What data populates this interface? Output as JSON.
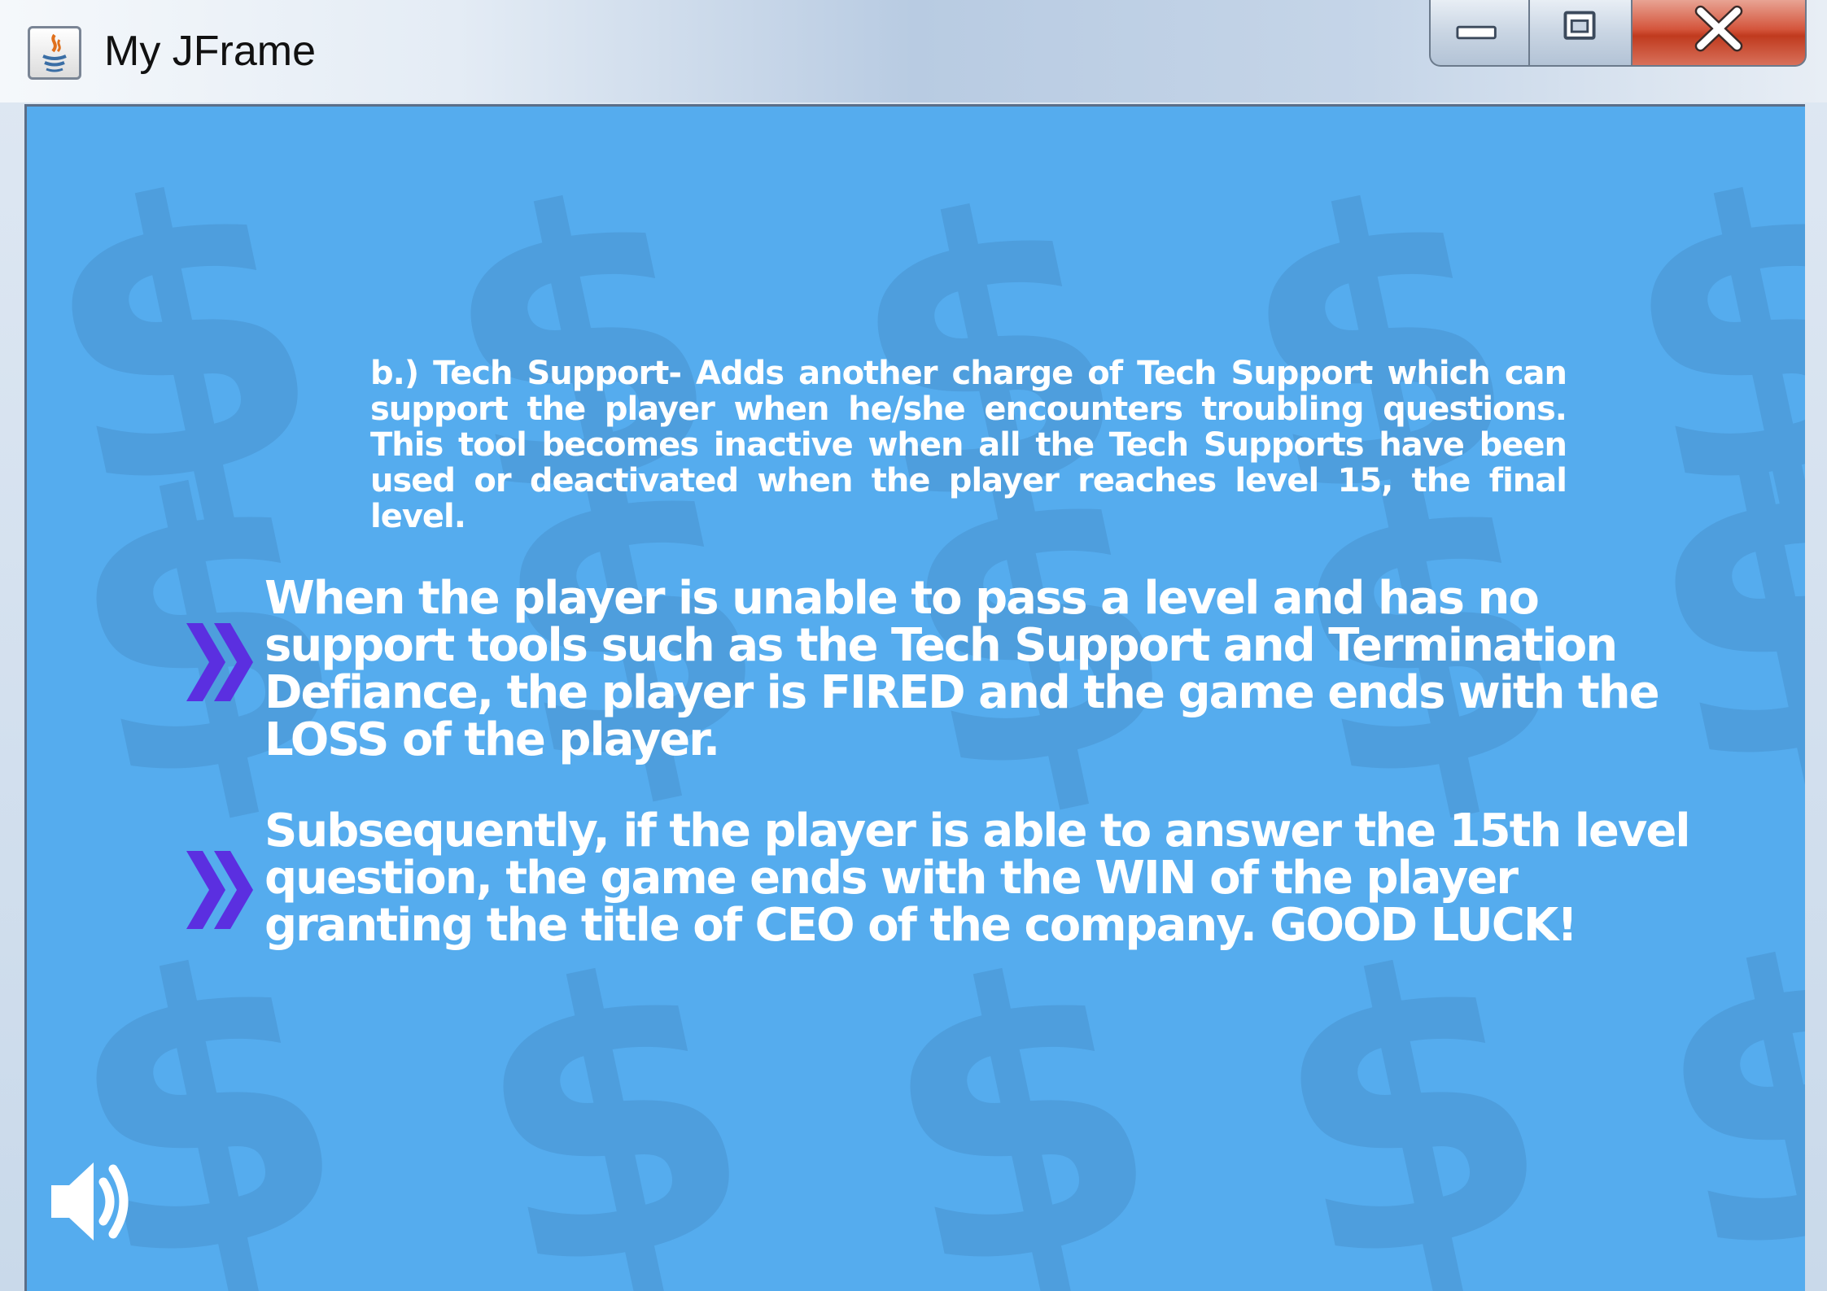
{
  "window": {
    "title": "My JFrame",
    "icon": "java-icon",
    "controls": [
      "minimize-icon",
      "maximize-icon",
      "close-icon"
    ]
  },
  "content": {
    "background_color": "#55acee",
    "watermark_glyph": "$",
    "paragraph": "b.) Tech Support- Adds another charge of Tech Support which can support the player when he/she encounters troubling questions. This tool becomes inactive when all the Tech Supports have been used or deactivated when the player reaches level 15, the final level.",
    "bullets": [
      {
        "icon": "double-chevron-right-icon",
        "text": "When the player is unable to pass a level and has no support tools such as the Tech Support and Termination Defiance, the player is FIRED and the game ends with the LOSS of the player."
      },
      {
        "icon": "double-chevron-right-icon",
        "text": "Subsequently, if the player is able to answer the 15th level question, the game ends with the WIN of the player granting the title of CEO of the company. GOOD LUCK!"
      }
    ],
    "bullet_color": "#5b2fe0",
    "sound_button": "speaker-icon"
  }
}
